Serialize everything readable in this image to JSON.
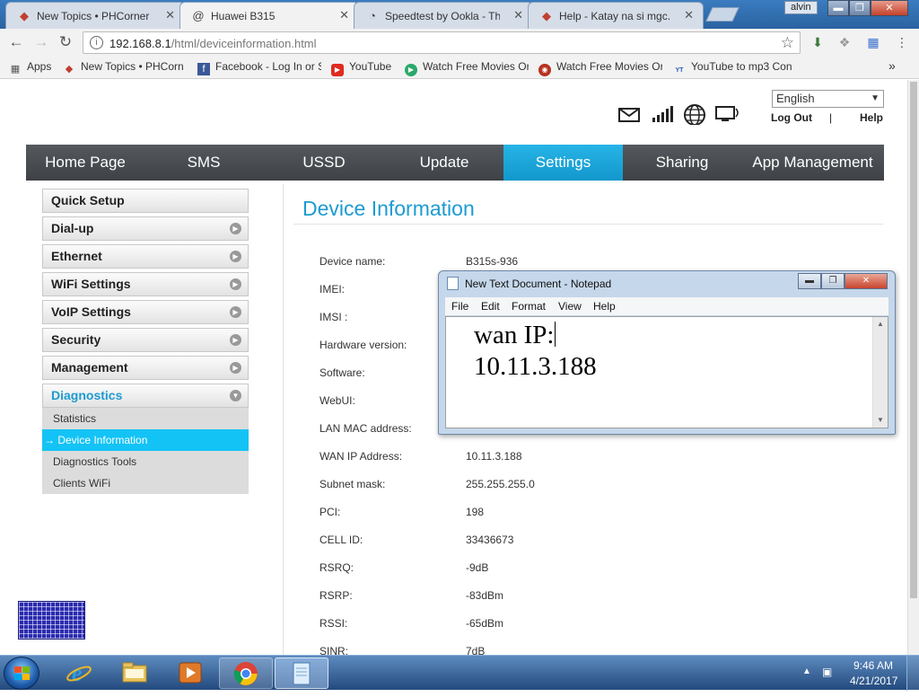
{
  "browser": {
    "tabs": [
      {
        "title": "New Topics • PHCorner",
        "favicon": "phcorner-icon",
        "active": false
      },
      {
        "title": "Huawei B315",
        "favicon": "at-icon",
        "active": true
      },
      {
        "title": "Speedtest by Ookla - The",
        "favicon": "speedtest-icon",
        "active": false
      },
      {
        "title": "Help - Katay na si mgc. s",
        "favicon": "phcorner-icon",
        "active": false
      }
    ],
    "profile_name": "alvin",
    "url_host": "192.168.8.1",
    "url_path": "/html/deviceinformation.html",
    "bookmarks": [
      {
        "label": "Apps",
        "icon": "apps-grid-icon"
      },
      {
        "label": "New Topics • PHCorn",
        "icon": "phcorner-icon"
      },
      {
        "label": "Facebook - Log In or S",
        "icon": "facebook-icon"
      },
      {
        "label": "YouTube",
        "icon": "youtube-icon"
      },
      {
        "label": "Watch Free Movies Or",
        "icon": "play-circle-icon"
      },
      {
        "label": "Watch Free Movies Or",
        "icon": "movie-icon"
      },
      {
        "label": "YouTube to mp3 Con",
        "icon": "mp3-icon"
      }
    ],
    "bookmarks_overflow": "»"
  },
  "router": {
    "language": "English",
    "logout_label": "Log Out",
    "separator": "|",
    "help_label": "Help",
    "nav": [
      {
        "label": "Home Page",
        "active": false
      },
      {
        "label": "SMS",
        "active": false
      },
      {
        "label": "USSD",
        "active": false
      },
      {
        "label": "Update",
        "active": false
      },
      {
        "label": "Settings",
        "active": true
      },
      {
        "label": "Sharing",
        "active": false
      },
      {
        "label": "App Management",
        "active": false
      }
    ],
    "sidebar": {
      "items": [
        {
          "label": "Quick Setup",
          "has_arrow": false
        },
        {
          "label": "Dial-up",
          "has_arrow": true
        },
        {
          "label": "Ethernet",
          "has_arrow": true
        },
        {
          "label": "WiFi Settings",
          "has_arrow": true
        },
        {
          "label": "VoIP Settings",
          "has_arrow": true
        },
        {
          "label": "Security",
          "has_arrow": true
        },
        {
          "label": "Management",
          "has_arrow": true
        },
        {
          "label": "Diagnostics",
          "has_arrow": true,
          "open": true
        }
      ],
      "subitems": [
        {
          "label": "Statistics",
          "active": false
        },
        {
          "label": "→ Device Information",
          "active": true
        },
        {
          "label": "Diagnostics Tools",
          "active": false
        },
        {
          "label": "Clients WiFi",
          "active": false
        }
      ]
    },
    "content": {
      "title": "Device Information",
      "rows": [
        {
          "label": "Device name:",
          "value": "B315s-936"
        },
        {
          "label": "IMEI:",
          "value": ""
        },
        {
          "label": "IMSI :",
          "value": ""
        },
        {
          "label": "Hardware version:",
          "value": ""
        },
        {
          "label": "Software:",
          "value": ""
        },
        {
          "label": "WebUI:",
          "value": ""
        },
        {
          "label": "LAN MAC address:",
          "value": ""
        },
        {
          "label": "WAN IP Address:",
          "value": "10.11.3.188"
        },
        {
          "label": "Subnet mask:",
          "value": "255.255.255.0"
        },
        {
          "label": "PCI:",
          "value": "198"
        },
        {
          "label": "CELL ID:",
          "value": "33436673"
        },
        {
          "label": "RSRQ:",
          "value": "-9dB"
        },
        {
          "label": "RSRP:",
          "value": "-83dBm"
        },
        {
          "label": "RSSI:",
          "value": "-65dBm"
        },
        {
          "label": "SINR:",
          "value": "7dB"
        }
      ]
    }
  },
  "notepad": {
    "title": "New Text Document - Notepad",
    "menus": [
      "File",
      "Edit",
      "Format",
      "View",
      "Help"
    ],
    "line1": "wan IP:",
    "line2": "10.11.3.188"
  },
  "taskbar": {
    "apps": [
      "internet-explorer-icon",
      "file-explorer-icon",
      "media-player-icon",
      "chrome-icon",
      "notepad-icon"
    ],
    "time": "9:46 AM",
    "date": "4/21/2017"
  },
  "colors": {
    "accent": "#1d9bd1",
    "nav_active": "#1397cc",
    "nav_bg": "#4a4e52",
    "taskbar": "#234a7e"
  }
}
